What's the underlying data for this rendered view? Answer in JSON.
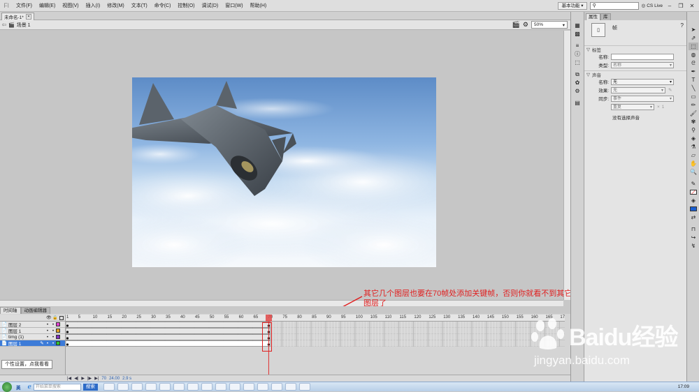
{
  "menubar": {
    "items": [
      "文件(F)",
      "编辑(E)",
      "视图(V)",
      "插入(I)",
      "修改(M)",
      "文本(T)",
      "命令(C)",
      "控制(O)",
      "调试(D)",
      "窗口(W)",
      "帮助(H)"
    ],
    "workspace": "基本功能",
    "cslive": "CS Live"
  },
  "document": {
    "tab_title": "未命名-1*",
    "scene": "场景 1",
    "zoom": "50%"
  },
  "timeline": {
    "tabs": [
      "时间轴",
      "动画编辑器"
    ],
    "layers": [
      {
        "name": "图层 2",
        "color": "#e040d0"
      },
      {
        "name": "图层 1",
        "color": "#e0a020"
      },
      {
        "name": "timg (1)",
        "color": "#8030c0"
      },
      {
        "name": "图层 1",
        "color": "#30c030",
        "selected": true
      }
    ],
    "ruler_labels": [
      "1",
      "5",
      "10",
      "15",
      "20",
      "25",
      "30",
      "35",
      "40",
      "45",
      "50",
      "55",
      "60",
      "65",
      "70",
      "75",
      "80",
      "85",
      "90",
      "95",
      "100",
      "105",
      "110",
      "115",
      "120",
      "125",
      "130",
      "135",
      "140",
      "145",
      "150",
      "155",
      "160",
      "165",
      "17"
    ],
    "current_frame": "70",
    "fps": "24.00",
    "time": "2.9 s"
  },
  "properties": {
    "tabs": [
      "属性",
      "库"
    ],
    "kind": "帧",
    "label_section": "标签",
    "name_label": "名称:",
    "type_label": "类型:",
    "type_value": "名称",
    "sound_section": "声音",
    "sound_name_label": "名称:",
    "sound_name_value": "无",
    "effect_label": "效果:",
    "effect_value": "无",
    "sync_label": "同步:",
    "sync_value": "事件",
    "repeat_value": "重复",
    "repeat_count": "1",
    "no_sound": "没有选择声音"
  },
  "annotation": {
    "text": "其它几个图层也要在70帧处添加关键帧，否则你就看不到其它图层了",
    "color": "#e02020"
  },
  "tooltip": "个性设置，点我看看",
  "watermark": {
    "brand": "Baidu经验",
    "url": "jingyan.baidu.com"
  },
  "taskbar": {
    "ime": "英",
    "search_placeholder": "开始菜单搜索",
    "search_btn": "搜索",
    "clock": "17:09"
  }
}
